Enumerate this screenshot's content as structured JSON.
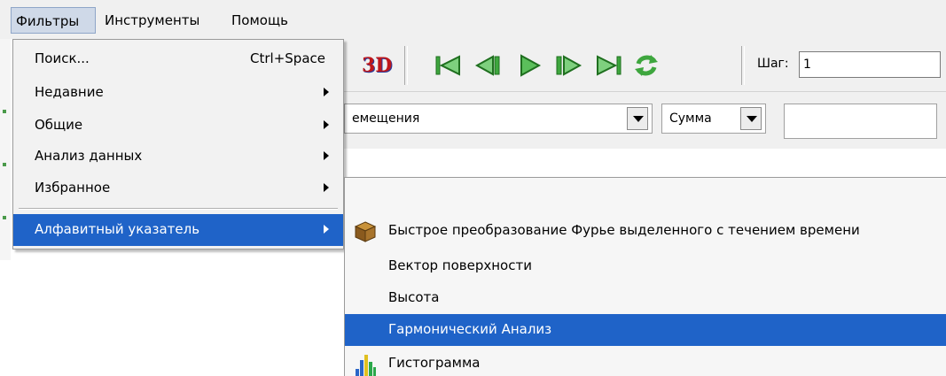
{
  "menubar": {
    "items": [
      {
        "label": "Фильтры"
      },
      {
        "label": "Инструменты"
      },
      {
        "label": "Помощь"
      }
    ]
  },
  "toolbar": {
    "btn_3d_label": "3D",
    "step_label": "Шаг:",
    "step_value": "1",
    "icons": [
      "first-frame-icon",
      "previous-frame-icon",
      "play-icon",
      "next-frame-icon",
      "last-frame-icon",
      "loop-icon"
    ],
    "accent_green": "#3ea63e"
  },
  "row2": {
    "variable_combo_value": "емещения",
    "aggregate_combo_value": "Сумма"
  },
  "filters_menu": {
    "items": [
      {
        "label": "Поиск...",
        "shortcut": "Ctrl+Space"
      },
      {
        "label": "Недавние"
      },
      {
        "label": "Общие"
      },
      {
        "label": "Анализ данных"
      },
      {
        "label": "Избранное"
      },
      {
        "label": "Алфавитный указатель"
      }
    ],
    "highlight_color": "#1f63c8"
  },
  "alphabetical_submenu": {
    "items": [
      {
        "label": "Быстрое преобразование Фурье выделенного с течением времени",
        "icon": "box-icon"
      },
      {
        "label": "Вектор поверхности"
      },
      {
        "label": "Высота"
      },
      {
        "label": "Гармонический Анализ"
      },
      {
        "label": "Гистограмма",
        "icon": "histogram-icon"
      }
    ]
  }
}
